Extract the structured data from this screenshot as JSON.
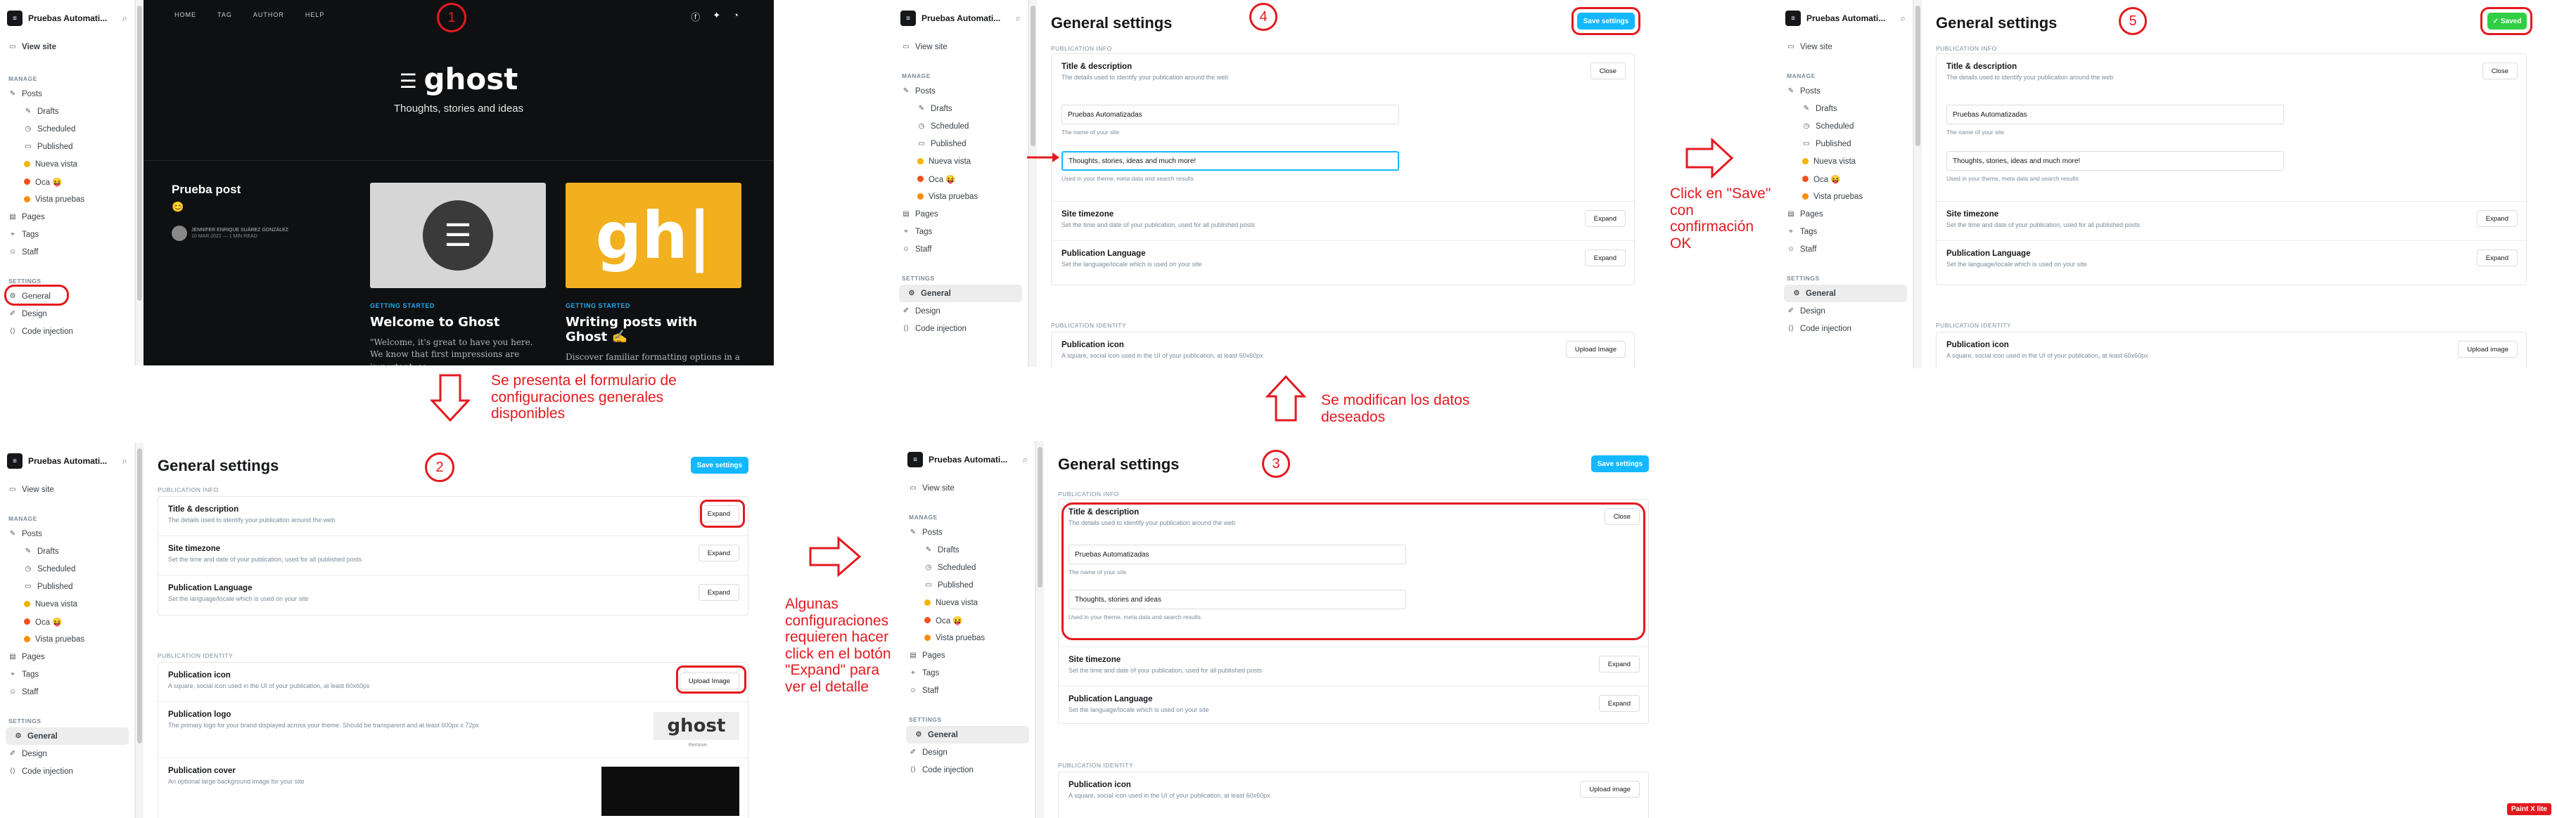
{
  "sidebar": {
    "site_name": "Pruebas Automatizadas",
    "site_name_short": "Pruebas Automati...",
    "view_site": "View site",
    "manage_caption": "MANAGE",
    "items": {
      "posts": "Posts",
      "drafts": "Drafts",
      "scheduled": "Scheduled",
      "published": "Published",
      "nueva_vista": "Nueva vista",
      "oca": "Oca 😝",
      "vista_pruebas": "Vista pruebas",
      "pages": "Pages",
      "tags": "Tags",
      "staff": "Staff"
    },
    "settings_caption": "SETTINGS",
    "settings_items": {
      "general": "General",
      "design": "Design",
      "code_injection": "Code injection"
    }
  },
  "blog": {
    "nav": [
      "HOME",
      "TAG",
      "AUTHOR",
      "HELP"
    ],
    "logo": "ghost",
    "tagline": "Thoughts, stories and ideas",
    "featured": {
      "title": "Prueba post",
      "emoji": "😊",
      "author": "JENNIFER ENRIQUE SUÁREZ GONZÁLEZ",
      "date": "10 MAR 2022 — 1 MIN READ"
    },
    "posts": [
      {
        "tag": "GETTING STARTED",
        "title": "Welcome to Ghost",
        "excerpt": "\"Welcome, it's great to have you here. We know that first impressions are important, so"
      },
      {
        "tag": "GETTING STARTED",
        "title": "Writing posts with Ghost ✍️",
        "excerpt": "Discover familiar formatting options in a functional toolbar and the ability to add"
      }
    ]
  },
  "settings": {
    "title": "General settings",
    "save": "Save settings",
    "saved": "✓ Saved",
    "publication_info": "PUBLICATION INFO",
    "publication_identity": "PUBLICATION IDENTITY",
    "title_desc": "Title & description",
    "title_desc_hint": "The details used to identify your publication around the web",
    "site_title_value": "Pruebas Automatizadas",
    "site_title_hint": "The name of your site",
    "description_value": "Thoughts, stories and ideas",
    "description_value_edited": "Thoughts, stories, ideas and much more!",
    "description_hint": "Used in your theme, meta data and search results",
    "site_timezone": "Site timezone",
    "site_timezone_hint": "Set the time and date of your publication, used for all published posts",
    "pub_language": "Publication Language",
    "pub_language_hint": "Set the language/locale which is used on your site",
    "pub_icon": "Publication icon",
    "pub_icon_hint": "A square, social icon used in the UI of your publication, at least 60x60px",
    "pub_logo": "Publication logo",
    "pub_logo_hint": "The primary logo for your brand displayed across your theme. Should be transparent and at least 600px x 72px",
    "pub_cover": "Publication cover",
    "pub_cover_hint": "An optional large background image for your site",
    "close": "Close",
    "expand": "Expand",
    "upload_image": "Upload Image",
    "upload_image_2": "Upload image",
    "ghost_logo": "ghost",
    "ghost_logo_sub": "Remove"
  },
  "annotations": {
    "step1": "1",
    "step2": "2",
    "step3": "3",
    "step4": "4",
    "step5": "5",
    "a1": "Se presenta el formulario de configuraciones generales disponibles",
    "a2": "Algunas configuraciones requieren hacer click en el botón \"Expand\" para ver el detalle",
    "a3": "Se modifican los datos deseados",
    "a4": "Click en \"Save\" con confirmación OK"
  },
  "badge": "Paint X lite",
  "colors": {
    "accent": "#14b8ff",
    "success": "#30cf43",
    "annotation": "#e4191f"
  }
}
